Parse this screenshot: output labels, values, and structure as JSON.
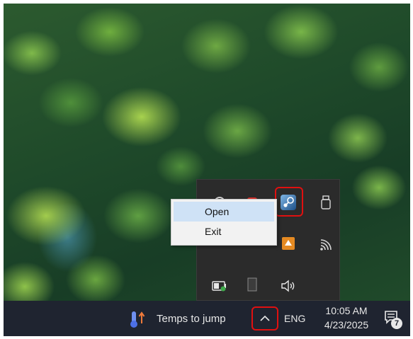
{
  "context_menu": {
    "items": [
      {
        "label": "Open",
        "selected": true
      },
      {
        "label": "Exit",
        "selected": false
      }
    ]
  },
  "taskbar": {
    "weather_text": "Temps to jump",
    "language": "ENG",
    "time": "10:05 AM",
    "date": "4/23/2025",
    "notification_count": "7"
  },
  "tray_icons": [
    "app-circle-icon",
    "red-app-icon",
    "steam-icon",
    "usb-drive-icon",
    "orange-app-icon",
    "wifi-icon",
    "battery-icon",
    "app-tile-icon",
    "volume-icon"
  ],
  "colors": {
    "highlight": "#e01010",
    "menu_selected": "#cfe2f6",
    "taskbar_bg": "#1f2430",
    "flyout_bg": "#2b2b2b"
  }
}
